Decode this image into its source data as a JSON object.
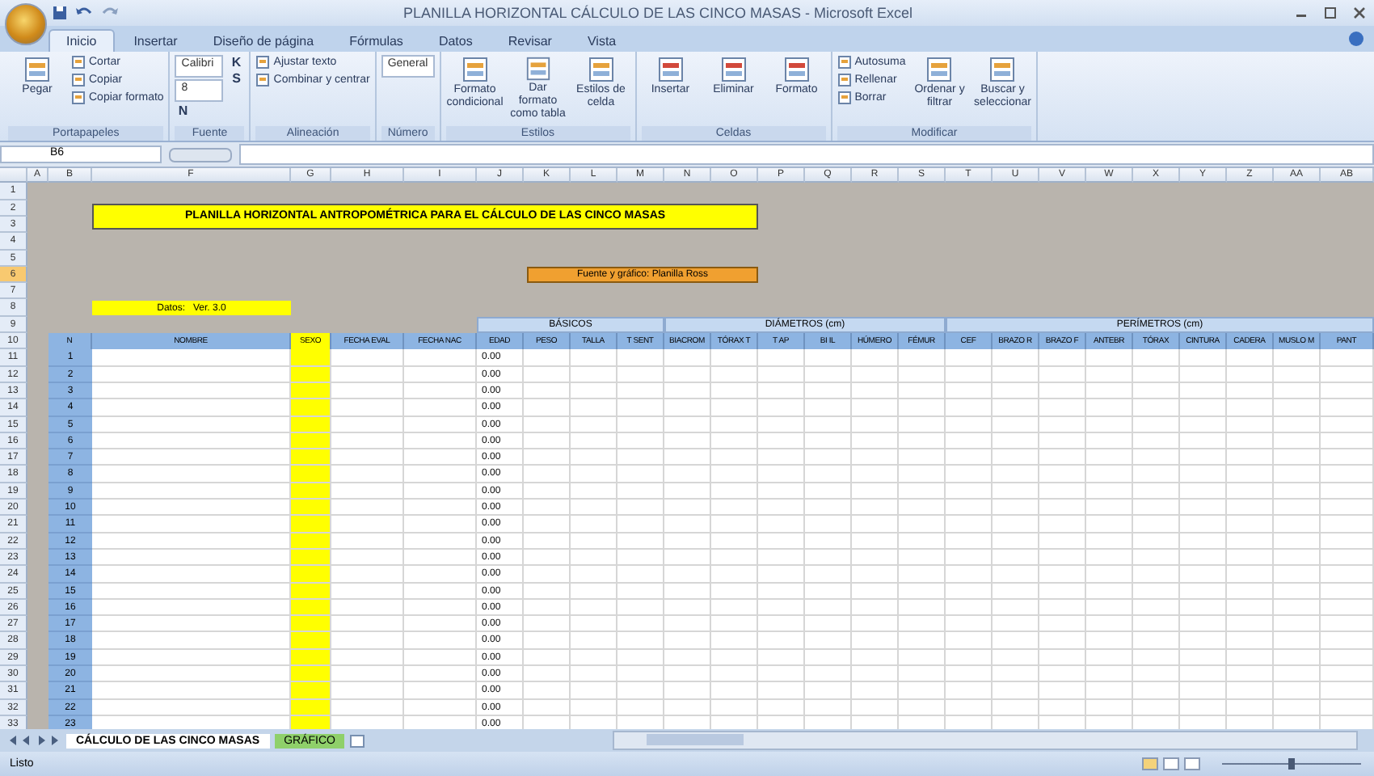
{
  "window": {
    "title": "PLANILLA HORIZONTAL CÁLCULO DE LAS CINCO MASAS - Microsoft Excel"
  },
  "tabs": [
    {
      "label": "Inicio",
      "selected": true
    },
    {
      "label": "Insertar",
      "selected": false
    },
    {
      "label": "Diseño de página",
      "selected": false
    },
    {
      "label": "Fórmulas",
      "selected": false
    },
    {
      "label": "Datos",
      "selected": false
    },
    {
      "label": "Revisar",
      "selected": false
    },
    {
      "label": "Vista",
      "selected": false
    }
  ],
  "ribbon": [
    {
      "label": "Portapapeles",
      "items": [
        {
          "kind": "large",
          "label": "Pegar"
        },
        {
          "kind": "small",
          "label": "Cortar"
        },
        {
          "kind": "small",
          "label": "Copiar"
        },
        {
          "kind": "small",
          "label": "Copiar formato"
        }
      ]
    },
    {
      "label": "Fuente",
      "items": [
        {
          "kind": "dropdown",
          "label": "Calibri"
        },
        {
          "kind": "dropdown",
          "label": "8"
        },
        {
          "kind": "key",
          "label": "N"
        },
        {
          "kind": "key",
          "label": "K"
        },
        {
          "kind": "key",
          "label": "S"
        }
      ]
    },
    {
      "label": "Alineación",
      "items": [
        {
          "kind": "small",
          "label": "Ajustar texto"
        },
        {
          "kind": "small",
          "label": "Combinar y centrar"
        }
      ]
    },
    {
      "label": "Número",
      "items": [
        {
          "kind": "dropdown",
          "label": "General"
        }
      ]
    },
    {
      "label": "Estilos",
      "items": [
        {
          "kind": "large",
          "label": "Formato condicional"
        },
        {
          "kind": "large",
          "label": "Dar formato como tabla"
        },
        {
          "kind": "large",
          "label": "Estilos de celda"
        }
      ]
    },
    {
      "label": "Celdas",
      "items": [
        {
          "kind": "large",
          "label": "Insertar"
        },
        {
          "kind": "large",
          "label": "Eliminar"
        },
        {
          "kind": "large",
          "label": "Formato"
        }
      ]
    },
    {
      "label": "Modificar",
      "items": [
        {
          "kind": "small",
          "label": "Autosuma"
        },
        {
          "kind": "small",
          "label": "Rellenar"
        },
        {
          "kind": "small",
          "label": "Borrar"
        },
        {
          "kind": "large",
          "label": "Ordenar y filtrar"
        },
        {
          "kind": "large",
          "label": "Buscar y seleccionar"
        }
      ]
    }
  ],
  "formula_bar": {
    "name_box": "B6"
  },
  "sheet": {
    "columns": [
      "A",
      "B",
      "F",
      "G",
      "H",
      "I",
      "J",
      "K",
      "L",
      "M",
      "N",
      "O",
      "P",
      "Q",
      "R",
      "S",
      "T",
      "U",
      "V",
      "W",
      "X",
      "Y",
      "Z",
      "AA",
      "AB"
    ],
    "rows": [
      {
        "number": "1",
        "selected": false
      },
      {
        "number": "2",
        "selected": false
      },
      {
        "number": "3",
        "selected": false
      },
      {
        "number": "4",
        "selected": false
      },
      {
        "number": "5",
        "selected": false
      },
      {
        "number": "6",
        "selected": true
      },
      {
        "number": "7",
        "selected": false
      },
      {
        "number": "8",
        "selected": false
      },
      {
        "number": "9",
        "selected": false
      },
      {
        "number": "10",
        "selected": false
      },
      {
        "number": "11",
        "selected": false
      },
      {
        "number": "12",
        "selected": false
      },
      {
        "number": "13",
        "selected": false
      },
      {
        "number": "14",
        "selected": false
      },
      {
        "number": "15",
        "selected": false
      },
      {
        "number": "16",
        "selected": false
      },
      {
        "number": "17",
        "selected": false
      },
      {
        "number": "18",
        "selected": false
      },
      {
        "number": "19",
        "selected": false
      },
      {
        "number": "20",
        "selected": false
      },
      {
        "number": "21",
        "selected": false
      },
      {
        "number": "22",
        "selected": false
      },
      {
        "number": "23",
        "selected": false
      },
      {
        "number": "24",
        "selected": false
      },
      {
        "number": "25",
        "selected": false
      },
      {
        "number": "26",
        "selected": false
      },
      {
        "number": "27",
        "selected": false
      },
      {
        "number": "28",
        "selected": false
      },
      {
        "number": "29",
        "selected": false
      },
      {
        "number": "30",
        "selected": false
      },
      {
        "number": "31",
        "selected": false
      },
      {
        "number": "32",
        "selected": false
      },
      {
        "number": "33",
        "selected": false
      }
    ],
    "title": "PLANILLA HORIZONTAL ANTROPOMÉTRICA PARA EL CÁLCULO DE LAS CINCO MASAS",
    "subtitle": "Fuente y gráfico: Planilla Ross",
    "info": "Datos:   Ver. 3.0",
    "headers": [
      "N",
      "NOMBRE",
      "SEXO",
      "FECHA EVAL",
      "FECHA NAC"
    ],
    "groups": [
      {
        "label": "BÁSICOS",
        "headers": [
          "EDAD",
          "PESO",
          "TALLA",
          "T SENT"
        ]
      },
      {
        "label": "DIÁMETROS (cm)",
        "headers": [
          "BIACROM",
          "TÓRAX T",
          "T AP",
          "BI IL",
          "HÚMERO",
          "FÉMUR"
        ]
      },
      {
        "label": "PERÍMETROS (cm)",
        "headers": [
          "CEF",
          "BRAZO R",
          "BRAZO F",
          "ANTEBR",
          "TÓRAX",
          "CINTURA",
          "CADERA",
          "MUSLO M",
          "PANT"
        ]
      }
    ],
    "records": [
      {
        "n": "1",
        "edad": "0.00"
      },
      {
        "n": "2",
        "edad": "0.00"
      },
      {
        "n": "3",
        "edad": "0.00"
      },
      {
        "n": "4",
        "edad": "0.00"
      },
      {
        "n": "5",
        "edad": "0.00"
      },
      {
        "n": "6",
        "edad": "0.00"
      },
      {
        "n": "7",
        "edad": "0.00"
      },
      {
        "n": "8",
        "edad": "0.00"
      },
      {
        "n": "9",
        "edad": "0.00"
      },
      {
        "n": "10",
        "edad": "0.00"
      },
      {
        "n": "11",
        "edad": "0.00"
      },
      {
        "n": "12",
        "edad": "0.00"
      },
      {
        "n": "13",
        "edad": "0.00"
      },
      {
        "n": "14",
        "edad": "0.00"
      },
      {
        "n": "15",
        "edad": "0.00"
      },
      {
        "n": "16",
        "edad": "0.00"
      },
      {
        "n": "17",
        "edad": "0.00"
      },
      {
        "n": "18",
        "edad": "0.00"
      },
      {
        "n": "19",
        "edad": "0.00"
      },
      {
        "n": "20",
        "edad": "0.00"
      },
      {
        "n": "21",
        "edad": "0.00"
      },
      {
        "n": "22",
        "edad": "0.00"
      },
      {
        "n": "23",
        "edad": "0.00"
      }
    ]
  },
  "sheet_tabs": [
    {
      "label": "CÁLCULO DE LAS CINCO MASAS",
      "selected": true
    },
    {
      "label": "GRÁFICO",
      "selected": false
    }
  ],
  "status_bar": {
    "text": "Listo",
    "zoom": {
      "level": 0.5
    }
  }
}
